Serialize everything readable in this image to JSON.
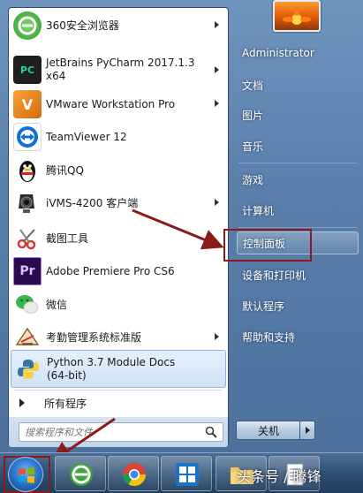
{
  "programs": [
    {
      "label": "360安全浏览器",
      "icon": "360-browser-icon",
      "color": "#3aa63c",
      "has_submenu": true
    },
    {
      "label": "JetBrains PyCharm 2017.1.3 x64",
      "icon": "pycharm-icon",
      "color": "#1e1e1e",
      "has_submenu": true
    },
    {
      "label": "VMware Workstation Pro",
      "icon": "vmware-icon",
      "color": "#f08b1e",
      "has_submenu": true
    },
    {
      "label": "TeamViewer 12",
      "icon": "teamviewer-icon",
      "color": "#0e6fd6",
      "has_submenu": false
    },
    {
      "label": "腾讯QQ",
      "icon": "qq-penguin-icon",
      "color": "#111111",
      "has_submenu": false
    },
    {
      "label": "iVMS-4200 客户端",
      "icon": "ivms-camera-icon",
      "color": "#222222",
      "has_submenu": true
    },
    {
      "label": "截图工具",
      "icon": "scissors-icon",
      "color": "#d23a3a",
      "has_submenu": false
    },
    {
      "label": "Adobe Premiere Pro CS6",
      "icon": "premiere-icon",
      "color": "#2b0a4f",
      "has_submenu": false
    },
    {
      "label": "微信",
      "icon": "wechat-icon",
      "color": "#39b54a",
      "has_submenu": false
    },
    {
      "label": "考勤管理系统标准版",
      "icon": "attendance-app-icon",
      "color": "#8a5a2b",
      "has_submenu": true
    },
    {
      "label": "Python 3.7 Module Docs (64-bit)",
      "icon": "python-icon",
      "color": "#3572a5",
      "has_submenu": false,
      "selected": true
    }
  ],
  "icon_glyphs": {
    "pycharm": "PC",
    "premiere": "Pr",
    "vmware": "V"
  },
  "all_programs": "所有程序",
  "search": {
    "placeholder": "搜索程序和文件"
  },
  "right_items": [
    {
      "label": "Administrator"
    },
    {
      "label": "文档"
    },
    {
      "label": "图片"
    },
    {
      "label": "音乐"
    },
    {
      "label": "游戏"
    },
    {
      "label": "计算机"
    },
    {
      "label": "控制面板",
      "highlighted": true
    },
    {
      "label": "设备和打印机"
    },
    {
      "label": "默认程序"
    },
    {
      "label": "帮助和支持"
    }
  ],
  "shutdown": {
    "label": "关机"
  },
  "taskbar": {
    "items": [
      "start-orb",
      "360-browser-taskbar-icon",
      "chrome-taskbar-icon",
      "start-tiles-taskbar-icon",
      "folder-taskbar-icon",
      "notepad-taskbar-icon"
    ]
  },
  "watermark": "头条号 / 腾锋",
  "colors": {
    "annotation_red": "#8b1a1a",
    "menu_blue": "#5a80ab"
  }
}
